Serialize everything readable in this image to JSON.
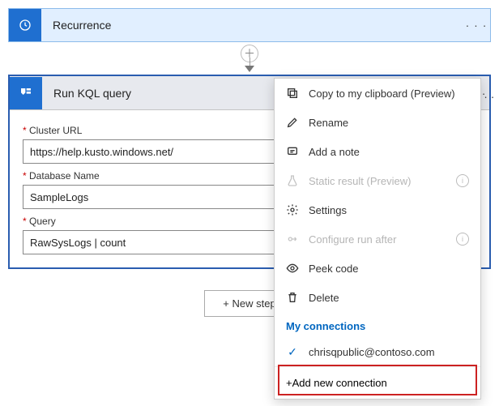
{
  "trigger": {
    "title": "Recurrence"
  },
  "action": {
    "title": "Run KQL query",
    "fields": {
      "clusterUrl": {
        "label": "Cluster URL",
        "value": "https://help.kusto.windows.net/"
      },
      "databaseName": {
        "label": "Database Name",
        "value": "SampleLogs"
      },
      "query": {
        "label": "Query",
        "value": "RawSysLogs | count"
      }
    }
  },
  "buttons": {
    "newStep": "+ New step"
  },
  "ctx": {
    "copy": "Copy to my clipboard (Preview)",
    "rename": "Rename",
    "note": "Add a note",
    "staticResult": "Static result (Preview)",
    "settings": "Settings",
    "configureRun": "Configure run after",
    "peek": "Peek code",
    "delete": "Delete",
    "connHeading": "My connections",
    "conn1": "chrisqpublic@contoso.com",
    "addConn": "+Add new connection"
  }
}
